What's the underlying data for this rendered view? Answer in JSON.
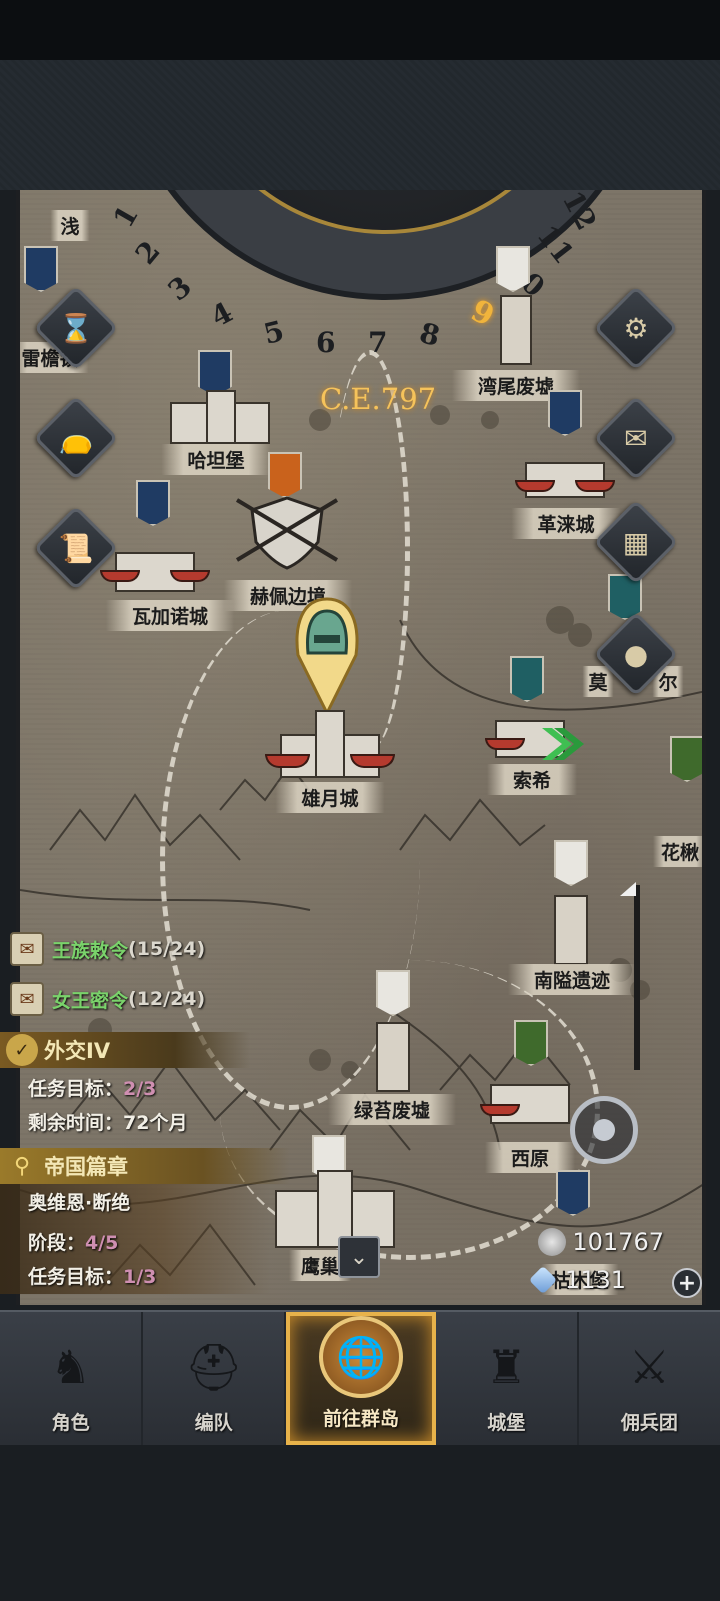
{
  "header": {
    "era": "C.E.797",
    "dial_months": [
      "1",
      "2",
      "3",
      "4",
      "5",
      "6",
      "7",
      "8",
      "9",
      "10",
      "11",
      "12"
    ],
    "current_month": "9"
  },
  "map": {
    "places": {
      "qian": "浅",
      "leiyan": "雷檐镇",
      "wanwei": "湾尾废墟",
      "hatan": "哈坦堡",
      "gelai": "革涞城",
      "hepei": "赫佩边境",
      "wajianuo": "瓦加诺城",
      "mo": "莫",
      "er": "尔",
      "xiongyue": "雄月城",
      "suoxi": "索希",
      "huajiao": "花楸",
      "nanai": "南隘遗迹",
      "lvtai": "绿苔废墟",
      "xiyuan": "西原",
      "yingchao": "鹰巢",
      "kumu": "枯木堡"
    }
  },
  "side_buttons": {
    "hourglass": "hourglass-icon",
    "bag": "bag-icon",
    "scroll": "scroll-icon",
    "settings": "gear-icon",
    "mail": "mail-icon",
    "grid": "grid-icon",
    "coin": "coin-icon"
  },
  "quests": {
    "royal_decree": {
      "title": "王族敕令",
      "count": "(15/24)"
    },
    "queen_secret": {
      "title": "女王密令",
      "count": "(12/24)"
    }
  },
  "diplomacy": {
    "title": "外交IV",
    "target_label": "任务目标：",
    "target_value": "2/3",
    "time_label": "剩余时间：",
    "time_value": "72个月"
  },
  "empire_chapter": {
    "title": "帝国篇章",
    "subtitle": "奥维恩·断绝",
    "stage_label": "阶段：",
    "stage_value": "4/5",
    "target_label": "任务目标：",
    "target_value": "1/3"
  },
  "resources": {
    "silver": "101767",
    "crystal": "1131"
  },
  "navbar": {
    "items": [
      "角色",
      "编队",
      "前往群岛",
      "城堡",
      "佣兵团"
    ],
    "active_index": 2
  },
  "colors": {
    "accent_gold": "#f0b43c",
    "quest_green": "#7ad36b",
    "progress_pink": "#cf8fb1",
    "map_parchment": "#7d7568"
  }
}
